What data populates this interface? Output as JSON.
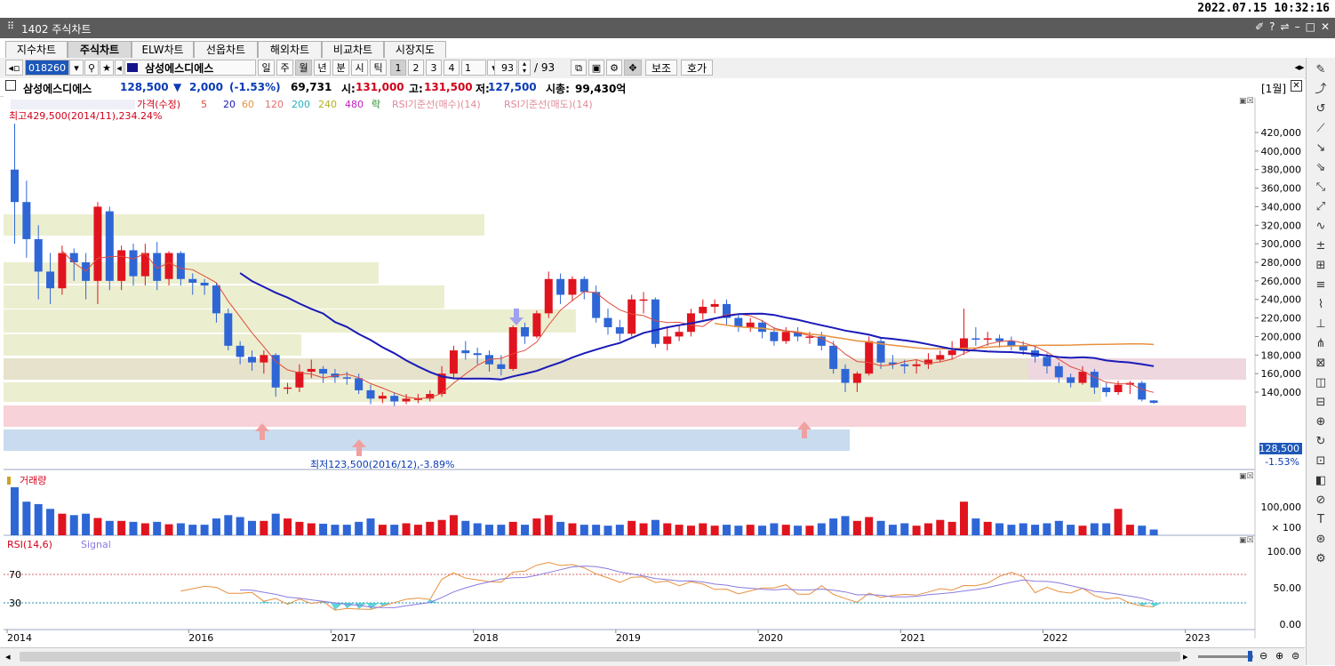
{
  "clock": "2022.07.15 10:32:16",
  "window": {
    "title": "1402 주식차트",
    "controls": [
      "✐",
      "?",
      "⇌",
      "–",
      "□",
      "✕"
    ]
  },
  "tabs": [
    "지수차트",
    "주식차트",
    "ELW차트",
    "선옵차트",
    "해외차트",
    "비교차트",
    "시장지도"
  ],
  "active_tab": 1,
  "toolbar": {
    "code": "018260",
    "name": "삼성에스디에스",
    "periods": [
      "일",
      "주",
      "월",
      "년",
      "분",
      "시",
      "틱"
    ],
    "active_period": "월",
    "multipliers": [
      "1",
      "2",
      "3",
      "4"
    ],
    "selected_multiplier": "1",
    "count": "93",
    "total": "/ 93",
    "aux_label": "보조",
    "quote_label": "호가"
  },
  "info": {
    "name": "삼성에스디에스",
    "price": "128,500",
    "arrow": "▼",
    "change": "2,000",
    "change_pct": "(-1.53%)",
    "volume": "69,731",
    "open_label": "시:",
    "open": "131,000",
    "high_label": "고:",
    "high": "131,500",
    "low_label": "저:",
    "low": "127,500",
    "cap_label": "시총:",
    "cap": "99,430억",
    "period_tag": "[1월]"
  },
  "legend": {
    "price": "가격(수정)",
    "ma": [
      "5",
      "20",
      "60",
      "120",
      "200",
      "240",
      "480"
    ],
    "rak": "락",
    "rsi_buy": "RSI기준선(매수)(14)",
    "rsi_sell": "RSI기준선(매도)(14)"
  },
  "annotations": {
    "max": "최고429,500(2014/11),234.24%",
    "min": "최저123,500(2016/12),-3.89%"
  },
  "price_axis": [
    "420,000",
    "400,000",
    "380,000",
    "360,000",
    "340,000",
    "320,000",
    "300,000",
    "280,000",
    "260,000",
    "240,000",
    "220,000",
    "200,000",
    "180,000",
    "160,000",
    "140,000"
  ],
  "price_tag": "128,500",
  "price_tag_pct": "-1.53%",
  "volume_panel": {
    "label": "거래량",
    "axis": [
      "100,000",
      "× 100"
    ]
  },
  "rsi_panel": {
    "label": "RSI(14,6)",
    "signal": "Signal",
    "axis": [
      "100.00",
      "50.00",
      "0.00"
    ],
    "levels": [
      "70",
      "30"
    ]
  },
  "years": [
    "2014",
    "2016",
    "2017",
    "2018",
    "2019",
    "2020",
    "2021",
    "2022",
    "2023"
  ],
  "colors": {
    "up": "#e0141e",
    "down": "#2e66d6",
    "ma20": "#1a1ab8",
    "ma5": "#e04a3a",
    "ma60": "#e88a3a"
  },
  "chart_data": {
    "type": "candlestick",
    "period": "monthly",
    "series": "월봉 (1개월) 삼성에스디에스",
    "ylim": [
      115000,
      440000
    ],
    "candles": [
      [
        380000,
        345000,
        429500,
        300000
      ],
      [
        345000,
        305000,
        368000,
        285000
      ],
      [
        305000,
        270000,
        320000,
        240000
      ],
      [
        270000,
        252000,
        290000,
        235000
      ],
      [
        252000,
        290000,
        298000,
        245000
      ],
      [
        290000,
        280000,
        295000,
        260000
      ],
      [
        280000,
        260000,
        290000,
        240000
      ],
      [
        260000,
        340000,
        345000,
        235000
      ],
      [
        335000,
        260000,
        340000,
        250000
      ],
      [
        260000,
        293000,
        298000,
        250000
      ],
      [
        293000,
        265000,
        300000,
        255000
      ],
      [
        265000,
        290000,
        300000,
        255000
      ],
      [
        290000,
        260000,
        302000,
        250000
      ],
      [
        262000,
        290000,
        292000,
        255000
      ],
      [
        290000,
        262000,
        292000,
        255000
      ],
      [
        262000,
        258000,
        268000,
        245000
      ],
      [
        258000,
        255000,
        262000,
        245000
      ],
      [
        255000,
        225000,
        258000,
        215000
      ],
      [
        225000,
        190000,
        230000,
        185000
      ],
      [
        190000,
        178000,
        195000,
        170000
      ],
      [
        178000,
        172000,
        185000,
        163000
      ],
      [
        172000,
        180000,
        185000,
        160000
      ],
      [
        180000,
        145000,
        182000,
        135000
      ],
      [
        145000,
        145000,
        150000,
        138000
      ],
      [
        145000,
        162000,
        170000,
        140000
      ],
      [
        162000,
        165000,
        175000,
        155000
      ],
      [
        165000,
        160000,
        168000,
        150000
      ],
      [
        160000,
        156000,
        165000,
        150000
      ],
      [
        156000,
        155000,
        162000,
        148000
      ],
      [
        155000,
        142000,
        160000,
        138000
      ],
      [
        142000,
        133000,
        148000,
        127000
      ],
      [
        133000,
        136000,
        140000,
        128000
      ],
      [
        136000,
        130000,
        140000,
        125000
      ],
      [
        130000,
        133000,
        138000,
        127000
      ],
      [
        133000,
        133000,
        138000,
        128000
      ],
      [
        133000,
        138000,
        142000,
        130000
      ],
      [
        138000,
        160000,
        168000,
        135000
      ],
      [
        160000,
        185000,
        190000,
        155000
      ],
      [
        185000,
        182000,
        195000,
        175000
      ],
      [
        182000,
        180000,
        188000,
        170000
      ],
      [
        180000,
        170000,
        185000,
        162000
      ],
      [
        170000,
        165000,
        180000,
        158000
      ],
      [
        165000,
        210000,
        212000,
        163000
      ],
      [
        210000,
        200000,
        215000,
        192000
      ],
      [
        200000,
        225000,
        228000,
        198000
      ],
      [
        225000,
        262000,
        270000,
        220000
      ],
      [
        262000,
        245000,
        268000,
        235000
      ],
      [
        245000,
        262000,
        265000,
        238000
      ],
      [
        262000,
        248000,
        265000,
        240000
      ],
      [
        248000,
        220000,
        255000,
        215000
      ],
      [
        220000,
        210000,
        230000,
        202000
      ],
      [
        210000,
        203000,
        218000,
        195000
      ],
      [
        203000,
        240000,
        245000,
        200000
      ],
      [
        240000,
        240000,
        248000,
        225000
      ],
      [
        240000,
        192000,
        242000,
        188000
      ],
      [
        192000,
        200000,
        210000,
        185000
      ],
      [
        200000,
        205000,
        212000,
        195000
      ],
      [
        205000,
        225000,
        230000,
        200000
      ],
      [
        225000,
        232000,
        240000,
        218000
      ],
      [
        232000,
        235000,
        240000,
        225000
      ],
      [
        235000,
        220000,
        240000,
        212000
      ],
      [
        220000,
        210000,
        225000,
        205000
      ],
      [
        210000,
        215000,
        220000,
        205000
      ],
      [
        215000,
        205000,
        218000,
        198000
      ],
      [
        205000,
        195000,
        210000,
        190000
      ],
      [
        195000,
        205000,
        210000,
        192000
      ],
      [
        205000,
        200000,
        210000,
        195000
      ],
      [
        200000,
        200000,
        205000,
        192000
      ],
      [
        200000,
        190000,
        205000,
        185000
      ],
      [
        190000,
        165000,
        195000,
        160000
      ],
      [
        165000,
        150000,
        170000,
        140000
      ],
      [
        150000,
        160000,
        162000,
        140000
      ],
      [
        160000,
        195000,
        200000,
        158000
      ],
      [
        195000,
        172000,
        198000,
        165000
      ],
      [
        172000,
        170000,
        180000,
        165000
      ],
      [
        170000,
        168000,
        175000,
        160000
      ],
      [
        168000,
        170000,
        175000,
        160000
      ],
      [
        170000,
        175000,
        182000,
        165000
      ],
      [
        175000,
        180000,
        185000,
        172000
      ],
      [
        180000,
        185000,
        195000,
        175000
      ],
      [
        185000,
        198000,
        230000,
        180000
      ],
      [
        198000,
        197000,
        210000,
        190000
      ],
      [
        197000,
        198000,
        205000,
        190000
      ],
      [
        198000,
        195000,
        202000,
        188000
      ],
      [
        195000,
        190000,
        200000,
        185000
      ],
      [
        190000,
        185000,
        195000,
        180000
      ],
      [
        185000,
        178000,
        190000,
        172000
      ],
      [
        178000,
        168000,
        182000,
        160000
      ],
      [
        168000,
        156000,
        172000,
        150000
      ],
      [
        156000,
        150000,
        160000,
        145000
      ],
      [
        150000,
        162000,
        168000,
        148000
      ],
      [
        162000,
        145000,
        165000,
        138000
      ],
      [
        145000,
        140000,
        150000,
        135000
      ],
      [
        140000,
        148000,
        152000,
        137000
      ],
      [
        148000,
        150000,
        152000,
        138000
      ],
      [
        150000,
        132000,
        152000,
        130000
      ],
      [
        131000,
        128500,
        131500,
        127500
      ]
    ]
  }
}
